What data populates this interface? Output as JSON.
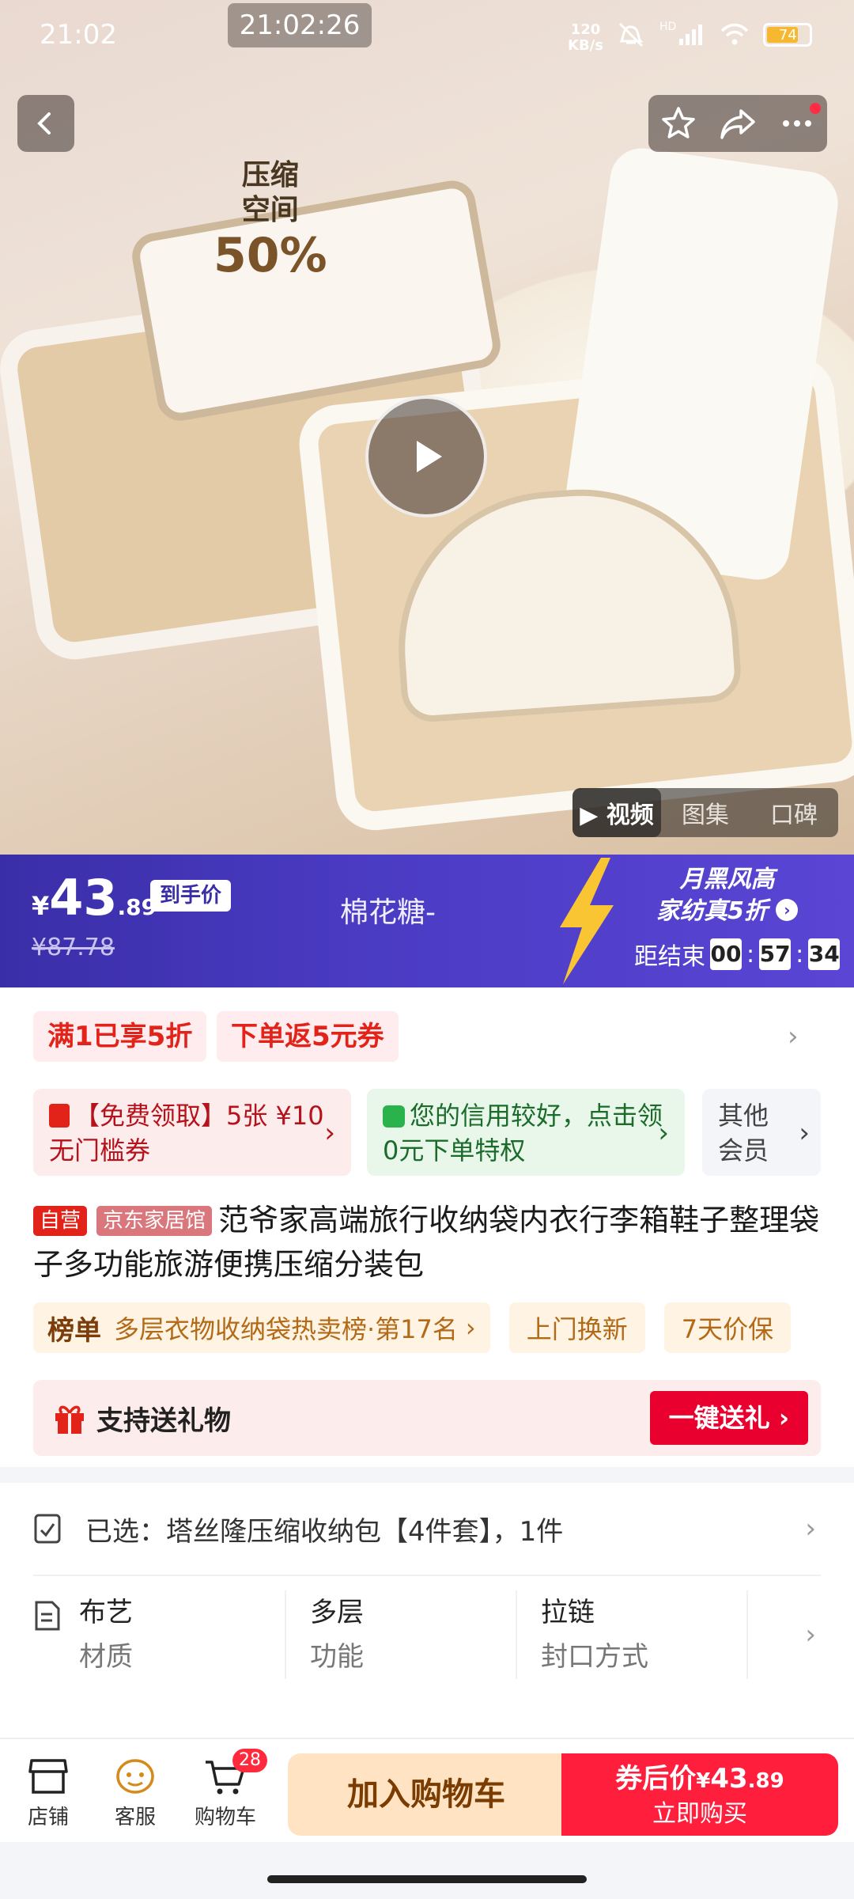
{
  "status_bar": {
    "time": "21:02",
    "clock": "21:02:26",
    "net_speed_top": "120",
    "net_speed_bottom": "KB/s",
    "battery": "74",
    "hd": "HD"
  },
  "hero": {
    "promo_line1": "压缩",
    "promo_line2": "空间",
    "promo_percent": "50%",
    "media_tabs": [
      "▶ 视频",
      "图集",
      "口碑"
    ]
  },
  "price_banner": {
    "currency": "¥",
    "price_int": "43",
    "price_dec": ".89",
    "price_tag": "到手价",
    "original_price": "¥87.78",
    "shop_name": "棉花糖-",
    "promo_line1": "月黑风高",
    "promo_line2": "家纺真5折",
    "countdown_label": "距结束",
    "countdown": [
      "00",
      "57",
      "34"
    ],
    "countdown_sep": ":"
  },
  "chips": [
    "满1已享5折",
    "下单返5元券"
  ],
  "benefits": [
    {
      "text": "【免费领取】5张 ¥10无门槛券",
      "icon": "coupon-icon"
    },
    {
      "text": "您的信用较好，点击领0元下单特权",
      "icon": "bag-icon"
    },
    {
      "text": "其他会员"
    }
  ],
  "product": {
    "tag_self": "自营",
    "tag_store": "京东家居馆",
    "title": "范爷家高端旅行收纳袋内衣行李箱鞋子整理袋子多功能旅游便携压缩分装包"
  },
  "rank": {
    "label": "榜单",
    "text": "多层衣物收纳袋热卖榜·第17名",
    "pills": [
      "上门换新",
      "7天价保"
    ]
  },
  "gift": {
    "label": "支持送礼物",
    "button": "一键送礼"
  },
  "selection": {
    "text": "已选：塔丝隆压缩收纳包【4件套】，1件"
  },
  "specs": [
    {
      "value": "布艺",
      "key": "材质"
    },
    {
      "value": "多层",
      "key": "功能"
    },
    {
      "value": "拉链",
      "key": "封口方式"
    }
  ],
  "bottom_bar": {
    "store": "店铺",
    "service": "客服",
    "cart": "购物车",
    "cart_count": "28",
    "add_cart": "加入购物车",
    "buy_price_prefix": "券后价",
    "buy_currency": "¥",
    "buy_price_int": "43",
    "buy_price_dec": ".89",
    "buy_now": "立即购买"
  },
  "colors": {
    "accent_red": "#e2231a",
    "banner_purple": "#3a2ea8",
    "buy_red": "#ff1f3d",
    "cart_orange": "#ffe3c2"
  }
}
